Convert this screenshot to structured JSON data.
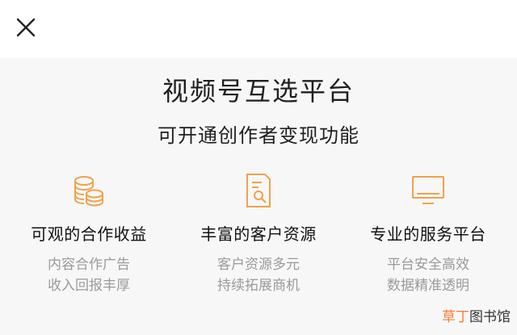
{
  "header": {
    "close_icon": "close-icon"
  },
  "title": "视频号互选平台",
  "subtitle": "可开通创作者变现功能",
  "features": [
    {
      "icon": "coins-icon",
      "title": "可观的合作收益",
      "desc1": "内容合作广告",
      "desc2": "收入回报丰厚"
    },
    {
      "icon": "document-search-icon",
      "title": "丰富的客户资源",
      "desc1": "客户资源多元",
      "desc2": "持续拓展商机"
    },
    {
      "icon": "monitor-icon",
      "title": "专业的服务平台",
      "desc1": "平台安全高效",
      "desc2": "数据精准透明"
    }
  ],
  "watermark": {
    "accent": "草丁",
    "rest": "图书馆"
  },
  "colors": {
    "accent": "#f0a24b",
    "title": "#1f1f1f",
    "muted": "#9a9a9a",
    "watermark_accent": "#ff7a2f"
  }
}
